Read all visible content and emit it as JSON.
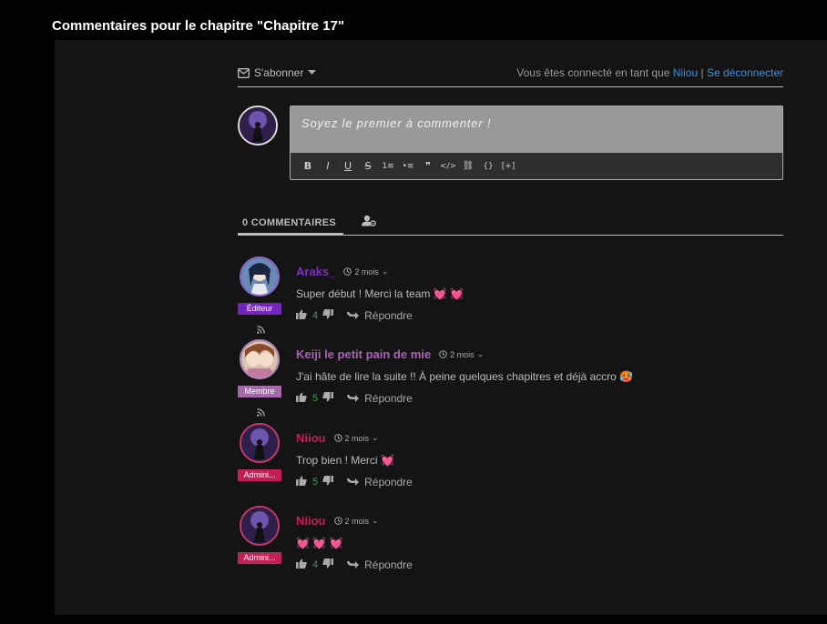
{
  "page_title": "Commentaires pour le chapitre \"Chapitre 17\"",
  "subscribe_label": "S'abonner",
  "login_prefix": "Vous êtes connecté en tant que",
  "login_user": "Niiou",
  "login_sep": "|",
  "logout_label": "Se déconnecter",
  "editor_placeholder": "Soyez le premier à commenter !",
  "toolbar": {
    "bold": "B",
    "italic": "I",
    "underline": "U",
    "strike": "S",
    "ol": "1≡",
    "ul": "•≡",
    "quote": "❞",
    "code": "</>",
    "link": "⛓",
    "braces": "{}",
    "expand": "[+]"
  },
  "comments_tab": "0 COMMENTAIRES",
  "comments": [
    {
      "author": "Araks_",
      "author_color": "#7b2fc0",
      "avatar_border": "#8b6acb",
      "badge": "Éditeur",
      "badge_color": "#7325c2",
      "time": "2 mois",
      "text": "Super début ! Merci la team",
      "emoji": "💓 💓",
      "votes": "4",
      "reply": "Répondre",
      "avatar_bg": "#6a8bb8",
      "avatar_fg": "#1c2540"
    },
    {
      "author": "Keiji le petit pain de mie",
      "author_color": "#a764b2",
      "avatar_border": "#b587bf",
      "badge": "Membre",
      "badge_color": "#a46bab",
      "time": "2 mois",
      "text": "J'ai hâte de lire la suite !! À peine quelques chapitres et déjà accro",
      "emoji": "🥵",
      "votes": "5",
      "reply": "Répondre",
      "avatar_bg": "#c9a48b",
      "avatar_fg": "#5a3b2c"
    },
    {
      "author": "Niiou",
      "author_color": "#c41e56",
      "avatar_border": "#c8386b",
      "badge": "Admini...",
      "badge_color": "#c41e56",
      "time": "2 mois",
      "text": "Trop bien ! Merci",
      "emoji": "💓",
      "votes": "5",
      "reply": "Répondre",
      "avatar_bg": "#2e1f4a",
      "avatar_fg": "#8a6bd6"
    },
    {
      "author": "Niiou",
      "author_color": "#c41e56",
      "avatar_border": "#c8386b",
      "badge": "Admini...",
      "badge_color": "#c41e56",
      "time": "2 mois",
      "text": "",
      "emoji": "💓 💓 💓",
      "votes": "4",
      "reply": "Répondre",
      "avatar_bg": "#2e1f4a",
      "avatar_fg": "#8a6bd6"
    }
  ],
  "colors": {
    "accent_link": "#3f8fd8",
    "vote_green": "#3c9c4c",
    "panel_bg": "#141414"
  },
  "icons": [
    "envelope-icon",
    "caret-down-icon",
    "user-gear-icon",
    "clock-icon",
    "thumbs-up-icon",
    "thumbs-down-icon",
    "reply-arrow-icon",
    "rss-icon"
  ]
}
